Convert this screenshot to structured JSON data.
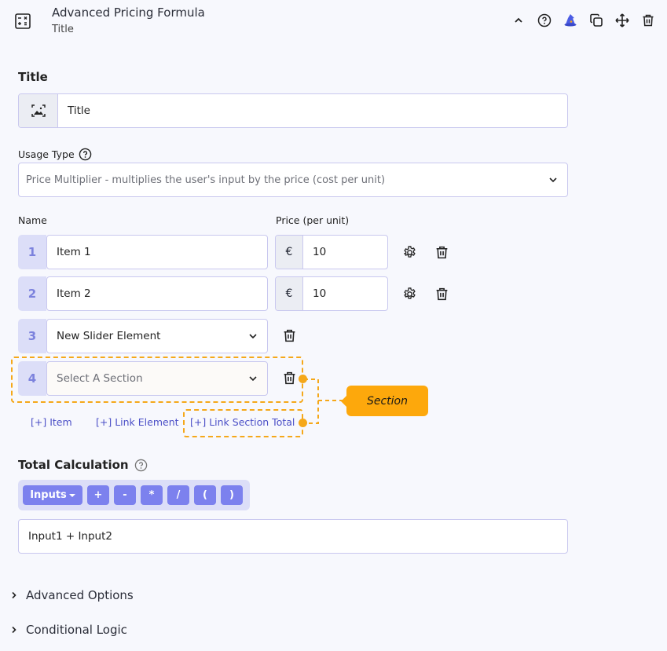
{
  "header": {
    "icon": "calculator-icon",
    "title": "Advanced Pricing Formula",
    "subtitle": "Title",
    "tools": [
      "chevron-up-icon",
      "help-icon",
      "wizard-hat-icon",
      "duplicate-icon",
      "move-icon",
      "trash-icon"
    ]
  },
  "title_section": {
    "label": "Title",
    "addon_icon": "image-icon",
    "value": "Title"
  },
  "usage_type": {
    "label": "Usage Type",
    "help_icon": "help-icon",
    "selected": "Price Multiplier - multiplies the user's input by the price (cost per unit)"
  },
  "items": {
    "name_header": "Name",
    "price_header": "Price (per unit)",
    "currency": "€",
    "rows": [
      {
        "number": "1",
        "name": "Item 1",
        "price": "10",
        "type": "item"
      },
      {
        "number": "2",
        "name": "Item 2",
        "price": "10",
        "type": "item"
      },
      {
        "number": "3",
        "name": "New Slider Element",
        "type": "element"
      },
      {
        "number": "4",
        "name": "Select A Section",
        "type": "section"
      }
    ]
  },
  "add_links": {
    "item": "[+] Item",
    "link_element": "[+] Link Element",
    "link_section_total": "[+] Link Section Total"
  },
  "annotation": {
    "label": "Section",
    "color": "#fda80c"
  },
  "total_calculation": {
    "label": "Total Calculation",
    "inputs_button": "Inputs",
    "operators": [
      "+",
      "-",
      "*",
      "/",
      "(",
      ")"
    ],
    "formula": "Input1 + Input2"
  },
  "collapsibles": [
    {
      "label": "Advanced Options"
    },
    {
      "label": "Conditional Logic"
    }
  ],
  "colors": {
    "accent": "#7c81ee",
    "link": "#4b4fc7",
    "badge_bg": "#dcdef8",
    "highlight": "#f5a81a"
  }
}
